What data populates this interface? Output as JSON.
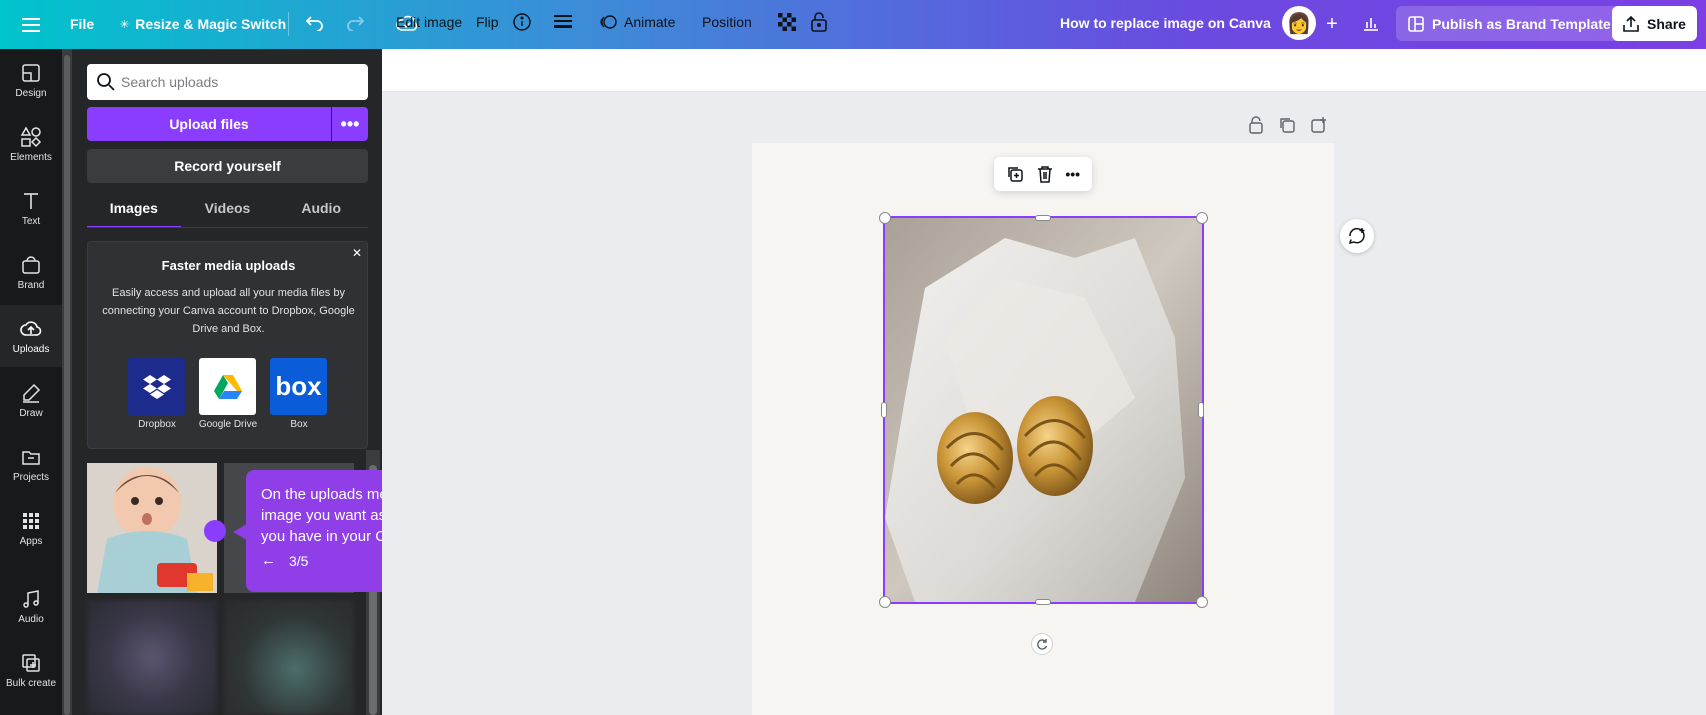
{
  "topbar": {
    "file_label": "File",
    "resize_label": "Resize & Magic Switch",
    "doc_title": "How to replace image on Canva",
    "publish_label": "Publish as Brand Template",
    "share_label": "Share",
    "brand_gradient": [
      "#00c4cc",
      "#7b3fe4"
    ]
  },
  "rail": {
    "items": [
      {
        "label": "Design",
        "icon": "design-icon"
      },
      {
        "label": "Elements",
        "icon": "elements-icon"
      },
      {
        "label": "Text",
        "icon": "text-icon"
      },
      {
        "label": "Brand",
        "icon": "brand-icon"
      },
      {
        "label": "Uploads",
        "icon": "uploads-icon",
        "active": true
      },
      {
        "label": "Draw",
        "icon": "draw-icon"
      },
      {
        "label": "Projects",
        "icon": "projects-icon"
      },
      {
        "label": "Apps",
        "icon": "apps-icon"
      },
      {
        "label": "Audio",
        "icon": "audio-icon"
      },
      {
        "label": "Bulk create",
        "icon": "bulk-create-icon"
      }
    ]
  },
  "uploads": {
    "search_placeholder": "Search uploads",
    "upload_label": "Upload files",
    "record_label": "Record yourself",
    "tabs": [
      "Images",
      "Videos",
      "Audio"
    ],
    "active_tab": "Images",
    "card": {
      "title": "Faster media uploads",
      "text": "Easily access and upload all your media files by connecting your Canva account to Dropbox, Google Drive and Box.",
      "providers": [
        {
          "label": "Dropbox",
          "color": "#1c2b8c"
        },
        {
          "label": "Google Drive",
          "color": "#ffffff"
        },
        {
          "label": "Box",
          "color": "#0a5cd8"
        }
      ]
    }
  },
  "tooltip": {
    "text": "On the uploads menu, choose and click the image you want as a replacement for the photo you have in your Canva.",
    "step": "3/5"
  },
  "editbar": {
    "edit_image": "Edit image",
    "flip": "Flip",
    "animate": "Animate",
    "position": "Position"
  },
  "colors": {
    "accent": "#8b3dff",
    "panel_bg": "#252627",
    "rail_bg": "#18191b"
  }
}
